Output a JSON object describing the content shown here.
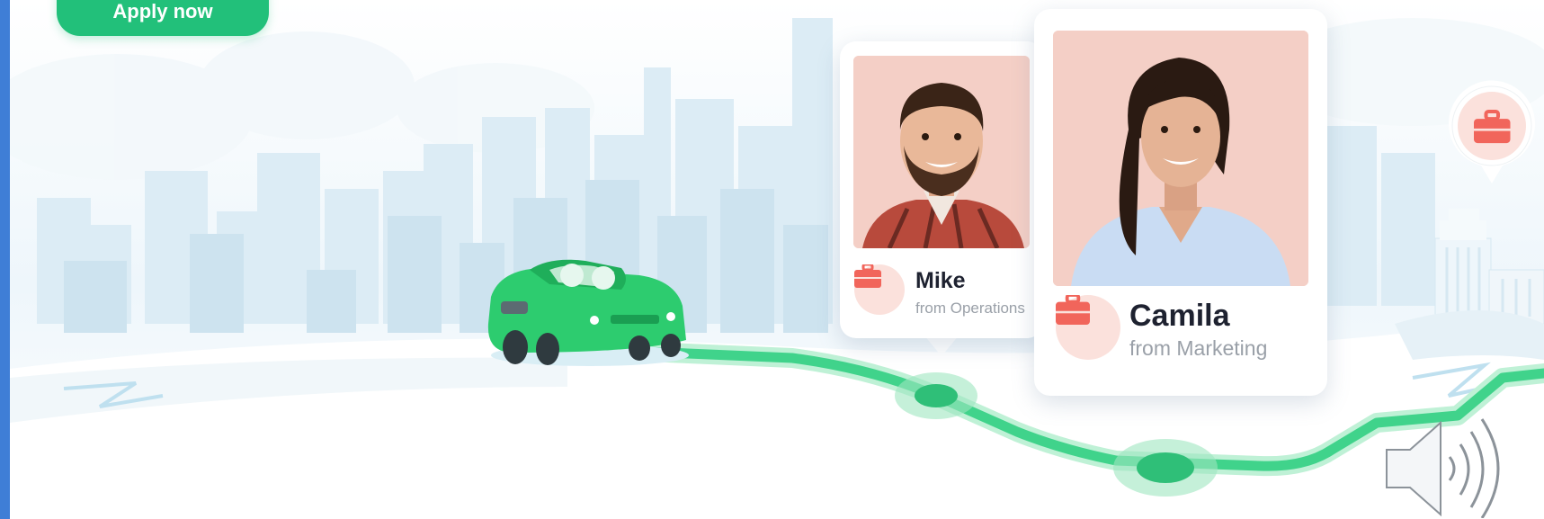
{
  "actions": {
    "apply_label": "Apply now"
  },
  "cards": [
    {
      "name": "Mike",
      "subtitle": "from Operations"
    },
    {
      "name": "Camila",
      "subtitle": "from Marketing"
    }
  ],
  "icons": {
    "badge": "briefcase-icon",
    "pin": "briefcase-icon",
    "sound": "speaker-icon"
  },
  "colors": {
    "brand_green": "#22c07a",
    "road_green": "#3fd68c",
    "badge_red": "#f1655b",
    "badge_bg": "#fbe1dc",
    "sky": "#eaf4fa",
    "left_strip": "#3f7ed6"
  }
}
